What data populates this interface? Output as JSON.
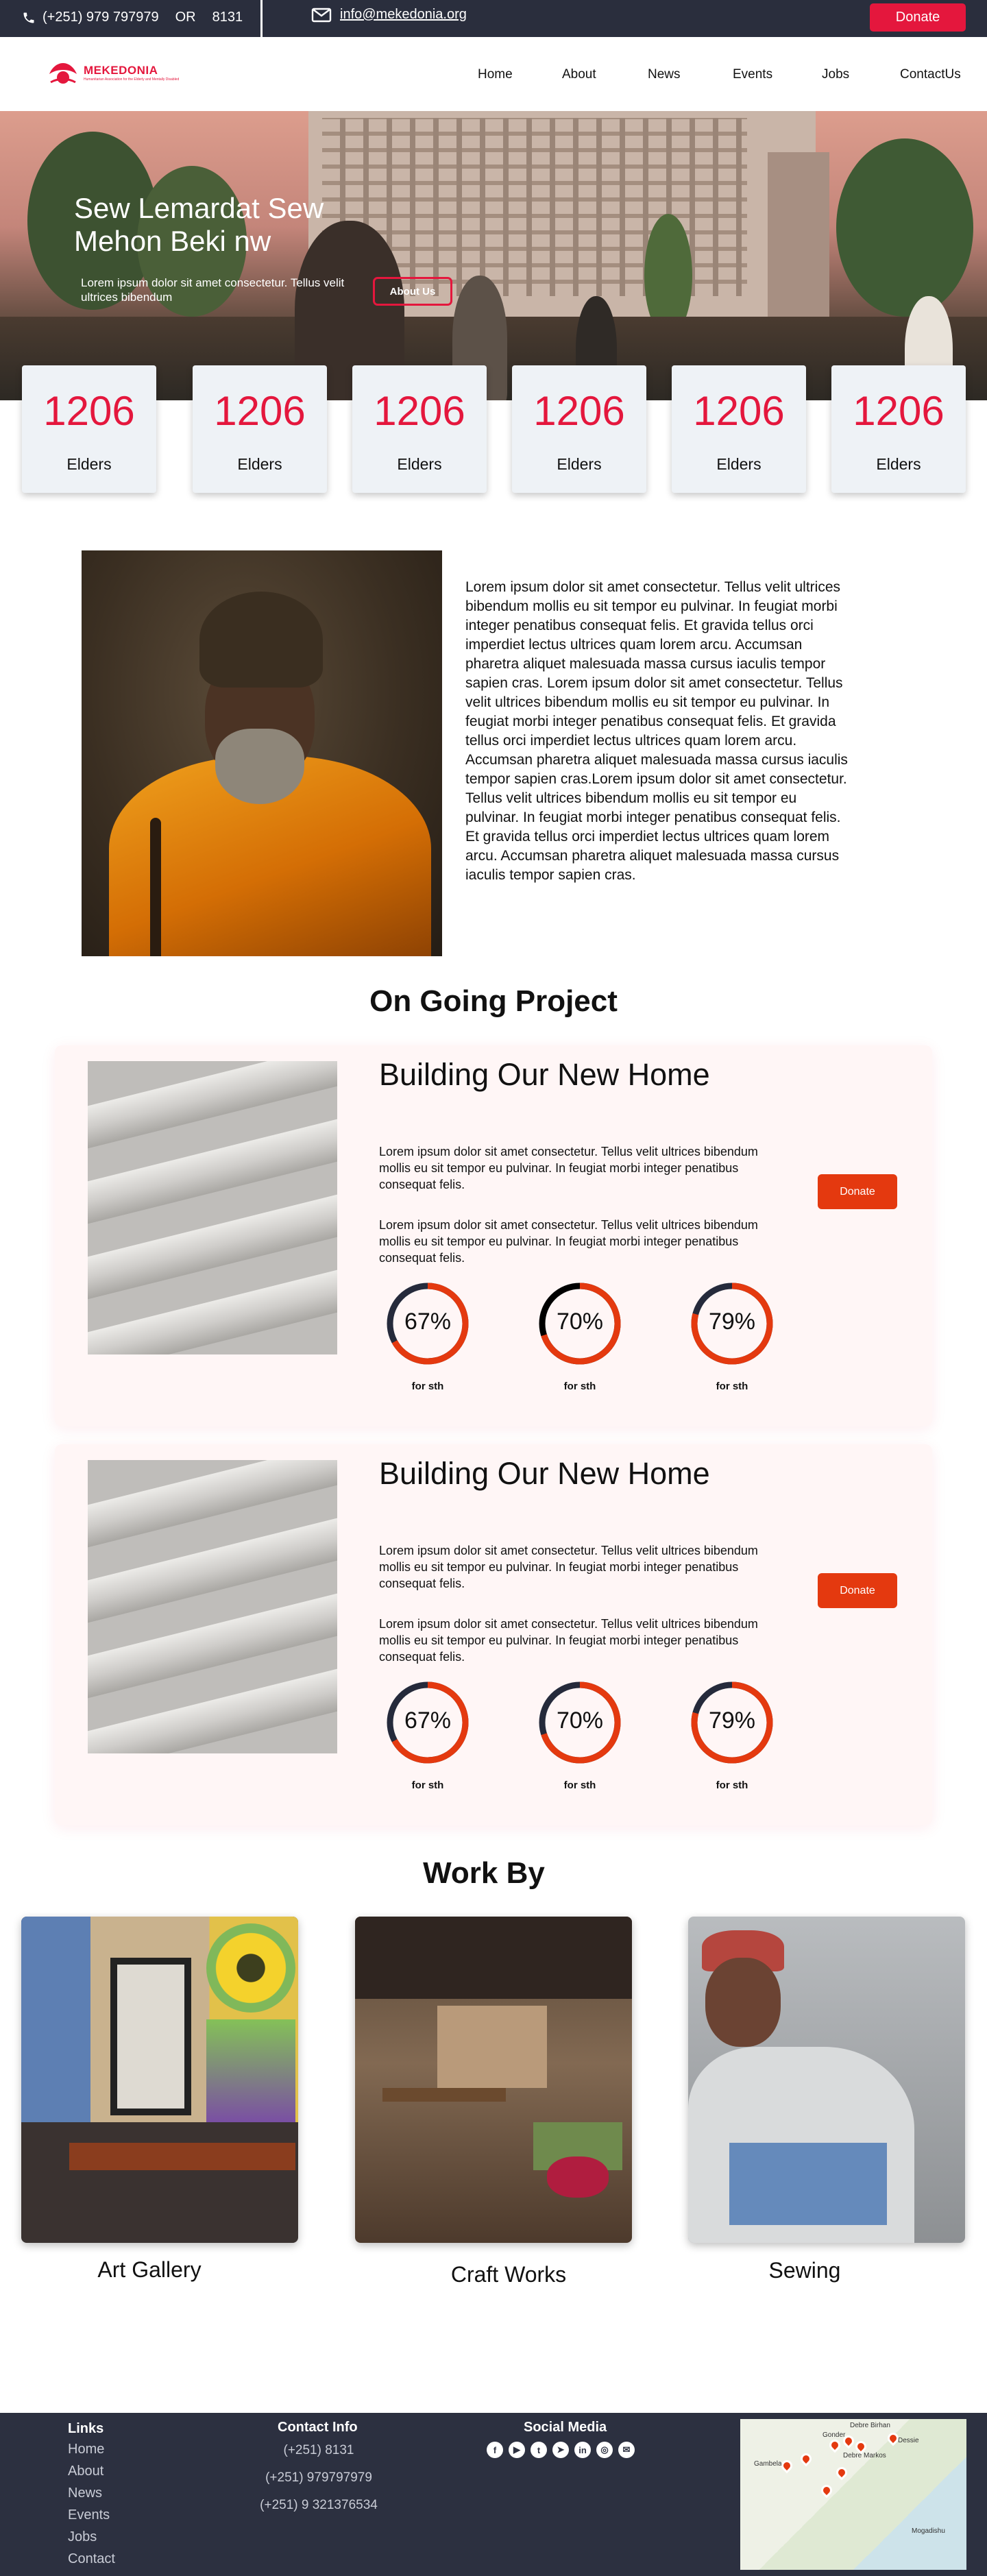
{
  "topbar": {
    "phone_icon": "phone-icon",
    "phone_text": "(+251) 979 797979",
    "or_text": "OR",
    "short_number": "8131",
    "mail_icon": "mail-icon",
    "email": "info@mekedonia.org",
    "donate_label": "Donate"
  },
  "nav": {
    "logo_text": "MEKEDONIA",
    "logo_sub": "Humanitarian Association for the Elderly and Mentally Disabled",
    "items": [
      "Home",
      "About",
      "News",
      "Events",
      "Jobs",
      "ContactUs"
    ]
  },
  "hero": {
    "title": "Sew Lemardat Sew Mehon Beki nw",
    "subtitle": "Lorem ipsum dolor sit amet consectetur. Tellus velit ultrices bibendum",
    "button_label": "About Us"
  },
  "stats": [
    {
      "number": "1206",
      "label": "Elders"
    },
    {
      "number": "1206",
      "label": "Elders"
    },
    {
      "number": "1206",
      "label": "Elders"
    },
    {
      "number": "1206",
      "label": "Elders"
    },
    {
      "number": "1206",
      "label": "Elders"
    },
    {
      "number": "1206",
      "label": "Elders"
    }
  ],
  "about": {
    "text": "Lorem ipsum dolor sit amet consectetur. Tellus velit ultrices bibendum mollis eu sit tempor eu pulvinar. In feugiat morbi integer penatibus consequat felis. Et gravida tellus orci imperdiet lectus ultrices quam lorem arcu. Accumsan pharetra aliquet malesuada massa cursus iaculis tempor sapien cras. Lorem ipsum dolor sit amet consectetur. Tellus velit ultrices bibendum mollis eu sit tempor eu pulvinar. In feugiat morbi integer penatibus consequat felis. Et gravida tellus orci imperdiet lectus ultrices quam lorem arcu. Accumsan pharetra aliquet malesuada massa cursus iaculis tempor sapien cras.Lorem ipsum dolor sit amet consectetur. Tellus velit ultrices bibendum mollis eu sit tempor eu pulvinar. In feugiat morbi integer penatibus consequat felis. Et gravida tellus orci imperdiet lectus ultrices quam lorem arcu. Accumsan pharetra aliquet malesuada massa cursus iaculis tempor sapien cras."
  },
  "projects_heading": "On Going Project",
  "projects": [
    {
      "title": "Building Our New Home",
      "para1": "Lorem ipsum dolor sit amet consectetur. Tellus velit ultrices bibendum mollis eu sit tempor eu pulvinar. In feugiat morbi integer penatibus consequat felis.",
      "para2": "Lorem ipsum dolor sit amet consectetur. Tellus velit ultrices bibendum mollis eu sit tempor eu pulvinar. In feugiat morbi integer penatibus consequat felis.",
      "donate_label": "Donate",
      "progress": [
        {
          "percent": 67,
          "text": "67%",
          "label": "for sth"
        },
        {
          "percent": 70,
          "text": "70%",
          "label": "for sth"
        },
        {
          "percent": 79,
          "text": "79%",
          "label": "for sth"
        }
      ]
    },
    {
      "title": "Building Our New Home",
      "para1": "Lorem ipsum dolor sit amet consectetur. Tellus velit ultrices bibendum mollis eu sit tempor eu pulvinar. In feugiat morbi integer penatibus consequat felis.",
      "para2": "Lorem ipsum dolor sit amet consectetur. Tellus velit ultrices bibendum mollis eu sit tempor eu pulvinar. In feugiat morbi integer penatibus consequat felis.",
      "donate_label": "Donate",
      "progress": [
        {
          "percent": 67,
          "text": "67%",
          "label": "for sth"
        },
        {
          "percent": 70,
          "text": "70%",
          "label": "for sth"
        },
        {
          "percent": 79,
          "text": "79%",
          "label": "for sth"
        }
      ]
    }
  ],
  "work_heading": "Work By",
  "work": [
    {
      "label": "Art Gallery"
    },
    {
      "label": "Craft Works"
    },
    {
      "label": "Sewing"
    }
  ],
  "footer": {
    "links_heading": "Links",
    "links": [
      "Home",
      "About",
      "News",
      "Events",
      "Jobs",
      "Contact"
    ],
    "contact_heading": "Contact Info",
    "contacts": [
      "(+251) 8131",
      "(+251) 979797979",
      "(+251) 9 321376534"
    ],
    "social_heading": "Social Media",
    "social_icons": [
      "facebook-icon",
      "youtube-icon",
      "twitter-icon",
      "telegram-icon",
      "linkedin-icon",
      "instagram-icon",
      "email-icon"
    ],
    "map_labels": [
      "Debre Birhan",
      "Gonder",
      "Debre Markos",
      "Dessie",
      "Gambela",
      "Mogadishu"
    ]
  },
  "colors": {
    "accent": "#e4173d",
    "donate_orange": "#e4390f",
    "dark": "#2a2e3d",
    "ring_track": "#252a3b"
  }
}
